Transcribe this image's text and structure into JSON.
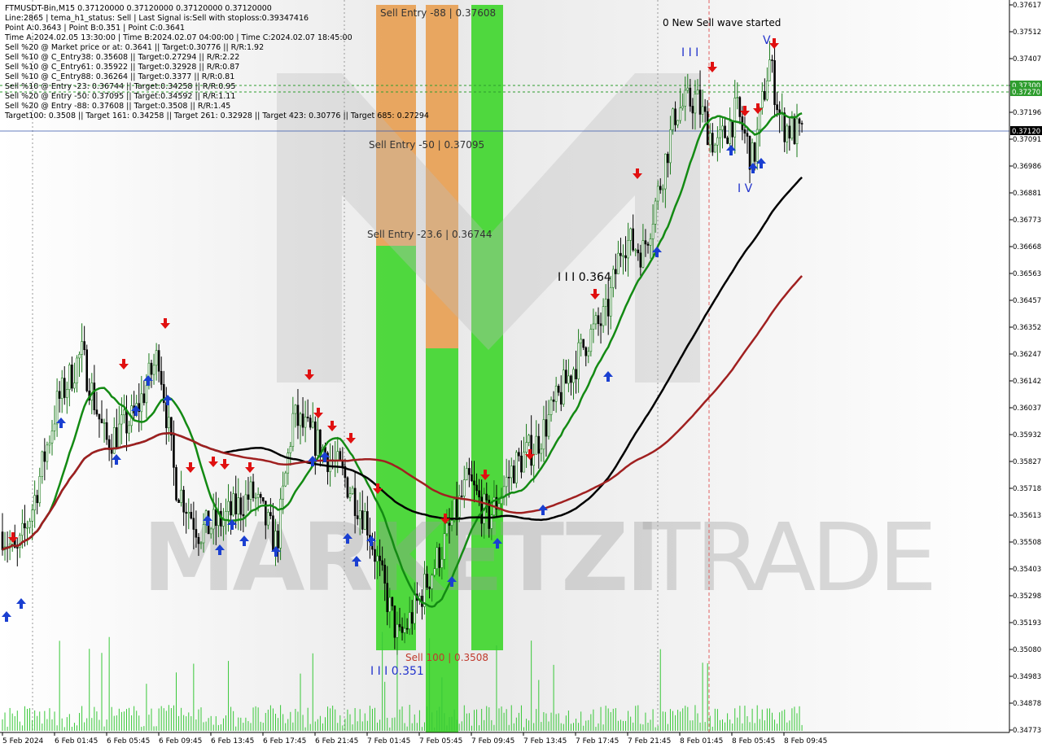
{
  "chart_data": {
    "type": "candlestick",
    "symbol_line": "FTMUSDT-Bin,M15  0.37120000 0.37120000 0.37120000 0.37120000",
    "info_lines": [
      "Line:2865 | tema_h1_status: Sell | Last Signal is:Sell with stoploss:0.39347416",
      "Point A:0.3643 | Point B:0.351 | Point C:0.3641",
      "Time A:2024.02.05 13:30:00 | Time B:2024.02.07 04:00:00 | Time C:2024.02.07 18:45:00",
      "Sell %20 @ Market price or at: 0.3641 || Target:0.30776 || R/R:1.92",
      "Sell %10 @ C_Entry38: 0.35608 || Target:0.27294 || R/R:2.22",
      "Sell %10 @ C_Entry61: 0.35922 || Target:0.32928 || R/R:0.87",
      "Sell %10 @ C_Entry88: 0.36264 || Target:0.3377 || R/R:0.81",
      "Sell %10 @ Entry -23: 0.36744 || Target:0.34258 || R/R:0.95",
      "Sell %20 @ Entry -50: 0.37095 || Target:0.34592 || R/R:1.11",
      "Sell %20 @ Entry -88: 0.37608 || Target:0.3508 || R/R:1.45",
      "Target100: 0.3508 || Target 161: 0.34258 || Target 261: 0.32928 || Target 423: 0.30776 || Target 685: 0.27294"
    ],
    "y_ticks": [
      "0.37617",
      "0.37512",
      "0.37407",
      "0.37302",
      "0.37196",
      "0.37091",
      "0.36986",
      "0.36881",
      "0.36773",
      "0.36668",
      "0.36563",
      "0.36457",
      "0.36352",
      "0.36247",
      "0.36142",
      "0.36037",
      "0.35932",
      "0.35827",
      "0.35718",
      "0.35613",
      "0.35508",
      "0.35403",
      "0.35298",
      "0.35193",
      "0.35080",
      "0.34983",
      "0.34878",
      "0.34773"
    ],
    "x_ticks": [
      "5 Feb 2024",
      "6 Feb 01:45",
      "6 Feb 05:45",
      "6 Feb 09:45",
      "6 Feb 13:45",
      "6 Feb 17:45",
      "6 Feb 21:45",
      "7 Feb 01:45",
      "7 Feb 05:45",
      "7 Feb 09:45",
      "7 Feb 13:45",
      "7 Feb 17:45",
      "7 Feb 21:45",
      "8 Feb 01:45",
      "8 Feb 05:45",
      "8 Feb 09:45"
    ],
    "price_labels": [
      {
        "text": "0.37300",
        "color": "#2e9d2e"
      },
      {
        "text": "0.37270",
        "color": "#2e9d2e"
      },
      {
        "text": "0.37120",
        "color": "#000000"
      }
    ],
    "annotations": [
      {
        "id": "sell-entry-88",
        "text": "Sell Entry -88 | 0.37608",
        "color": "#333333"
      },
      {
        "id": "sell-entry-50",
        "text": "Sell Entry -50 | 0.37095",
        "color": "#333333"
      },
      {
        "id": "sell-entry-23",
        "text": "Sell Entry -23.6 | 0.36744",
        "color": "#333333"
      },
      {
        "id": "sell-100",
        "text": "Sell 100 | 0.3508",
        "color": "#c0392b"
      },
      {
        "id": "wave-iii-low",
        "text": "I I I 0.351",
        "color": "#2233cc"
      },
      {
        "id": "wave-iii-high",
        "text": "I I I 0.364",
        "color": "#000000"
      },
      {
        "id": "new-wave",
        "text": "0 New Sell wave started",
        "color": "#000000"
      },
      {
        "id": "wave-iii-top",
        "text": "I I I",
        "color": "#2233cc"
      },
      {
        "id": "wave-v",
        "text": "V",
        "color": "#2233cc"
      },
      {
        "id": "wave-iv",
        "text": "I V",
        "color": "#2233cc"
      }
    ],
    "watermark": "MARKETZITRADE",
    "colors": {
      "up": "#1a7a1a",
      "down": "#000000",
      "ma_fast": "#138a13",
      "ma_mid": "#000000",
      "ma_slow": "#a02020",
      "buy_arrow": "#1a3fd1",
      "sell_arrow": "#e01010",
      "zone_orange": "#e89a48",
      "zone_green": "#3ed62b"
    }
  }
}
